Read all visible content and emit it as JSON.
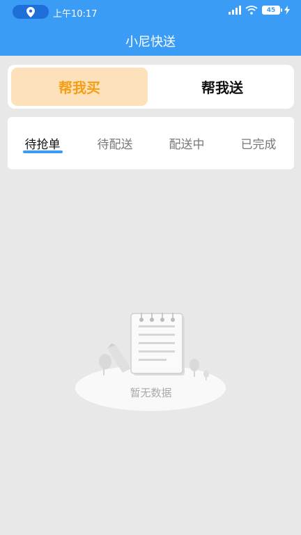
{
  "status_bar": {
    "time": "上午10:17",
    "battery": "45"
  },
  "header": {
    "title": "小尼快送"
  },
  "mode": {
    "buy_label": "帮我买",
    "send_label": "帮我送"
  },
  "tabs": [
    {
      "label": "待抢单"
    },
    {
      "label": "待配送"
    },
    {
      "label": "配送中"
    },
    {
      "label": "已完成"
    }
  ],
  "empty_state": {
    "message": "暂无数据"
  },
  "colors": {
    "primary": "#3b9cf6",
    "accent": "#f59e14",
    "accent_bg": "#fde1ba"
  },
  "icons": [
    "location-icon",
    "signal-icon",
    "wifi-icon",
    "battery-icon",
    "charging-icon",
    "empty-notebook-icon"
  ]
}
